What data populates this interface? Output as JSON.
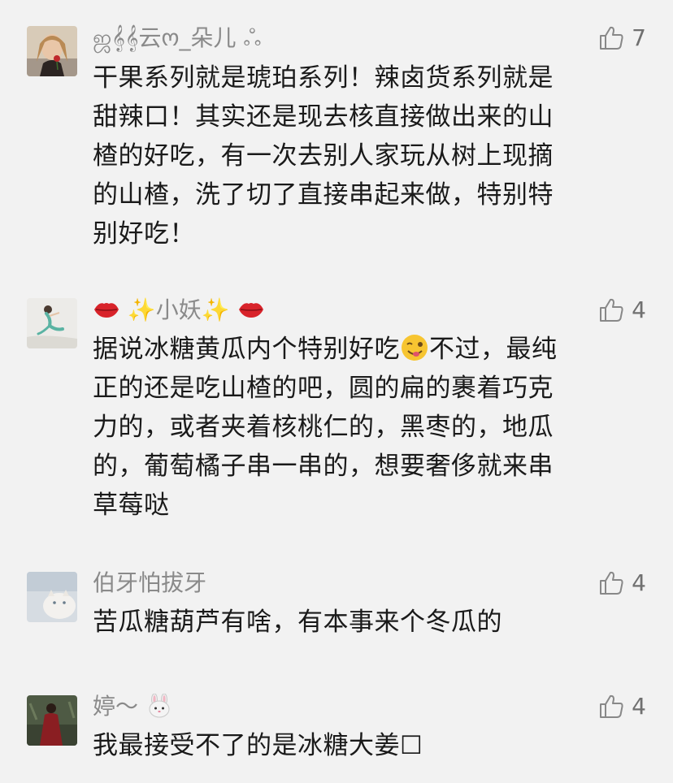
{
  "comments": [
    {
      "nickname": "ஜ𝄞𝄞云ო_朵儿 ஃ",
      "likes": "7",
      "text": "干果系列就是琥珀系列！辣卤货系列就是\n甜辣口！其实还是现去核直接做出来的山\n楂的好吃，有一次去别人家玩从树上现摘\n的山楂，洗了切了直接串起来做，特别特\n别好吃！"
    },
    {
      "nickname_left_emoji": "💋",
      "nickname_core": "✨小妖✨",
      "nickname_right_emoji": "💋",
      "likes": "4",
      "text_before_emoji": "据说冰糖黄瓜内个特别好吃",
      "text_after_emoji": "不过，最纯\n正的还是吃山楂的吧，圆的扁的裹着巧克\n力的，或者夹着核桃仁的，黑枣的，地瓜\n的，葡萄橘子串一串的，想要奢侈就来串\n草莓哒"
    },
    {
      "nickname": "伯牙怕拔牙",
      "likes": "4",
      "text": "苦瓜糖葫芦有啥，有本事来个冬瓜的"
    },
    {
      "nickname": "婷～",
      "nickname_emoji": "🐰",
      "likes": "4",
      "text": "我最接受不了的是冰糖大姜☐"
    }
  ],
  "icons": {
    "like": "thumbs-up-outline-icon",
    "inline_emoji": "winking-tongue-face-emoji"
  },
  "colors": {
    "background": "#f2f2f2",
    "nickname": "#8a8a8a",
    "text": "#1a1a1a",
    "icon": "#888888"
  }
}
